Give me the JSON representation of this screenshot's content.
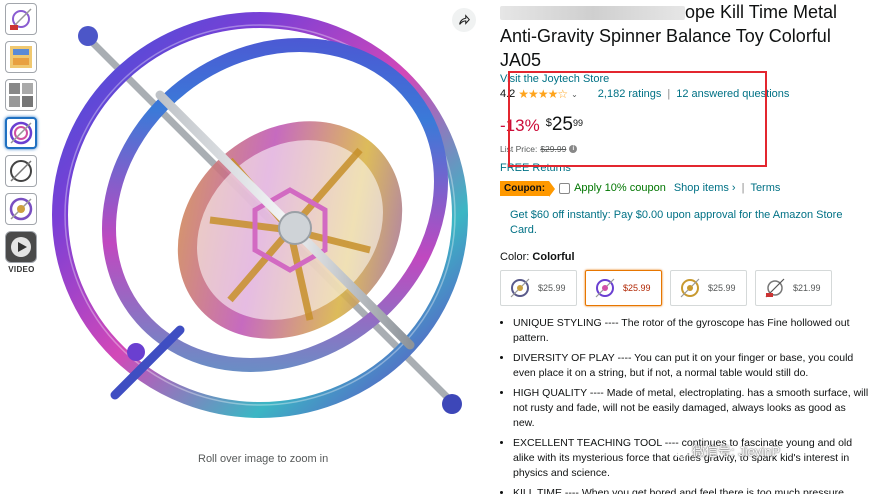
{
  "product": {
    "title_visible": "ope Kill Time Metal Anti-Gravity Spinner Balance Toy Colorful JA05",
    "store_link": "Visit the Joytech Store",
    "rating_value": "4.2",
    "stars_display": "★★★★☆",
    "ratings_count": "2,182 ratings",
    "separator": "|",
    "answered_questions": "12 answered questions",
    "discount": "-13%",
    "price_currency": "$",
    "price_whole": "25",
    "price_fraction": "99",
    "list_price_label": "List Price:",
    "list_price_value": "$29.99",
    "returns": "FREE Returns",
    "coupon_badge": "Coupon:",
    "coupon_text": "Apply 10% coupon",
    "shop_items": "Shop items ›",
    "terms": "Terms",
    "promo": "Get $60 off instantly: Pay $0.00 upon approval for the Amazon Store Card.",
    "color_label": "Color:",
    "color_value": "Colorful",
    "swatches": [
      {
        "price": "$25.99",
        "selected": false
      },
      {
        "price": "$25.99",
        "selected": true
      },
      {
        "price": "$25.99",
        "selected": false
      },
      {
        "price": "$21.99",
        "selected": false
      }
    ],
    "bullets": [
      "UNIQUE STYLING ---- The rotor of the gyroscope has Fine hollowed out pattern.",
      "DIVERSITY OF PLAY ---- You can put it on your finger or base, you could even place it on a string, but if not, a normal table would still do.",
      "HIGH QUALITY ---- Made of metal, electroplating. has a smooth surface, will not rusty and fade, will not be easily damaged, always looks as good as new.",
      "EXCELLENT TEACHING TOOL ---- continues to fascinate young and old alike with its mysterious force that defies gravity, to spark kid's interest in physics and science.",
      "KILL TIME ---- When you get bored and feel there is too much pressure"
    ]
  },
  "gallery": {
    "video_label": "VIDEO",
    "zoom_hint": "Roll over image to zoom in",
    "share_icon": "share-icon"
  },
  "watermark": {
    "text": "微信号: JieyinP"
  },
  "colors": {
    "link": "#007185",
    "deal_red": "#cc0c39",
    "highlight_box": "#e3262f",
    "coupon_orange": "#ff9900",
    "selected_thumb": "#1f70c1"
  }
}
